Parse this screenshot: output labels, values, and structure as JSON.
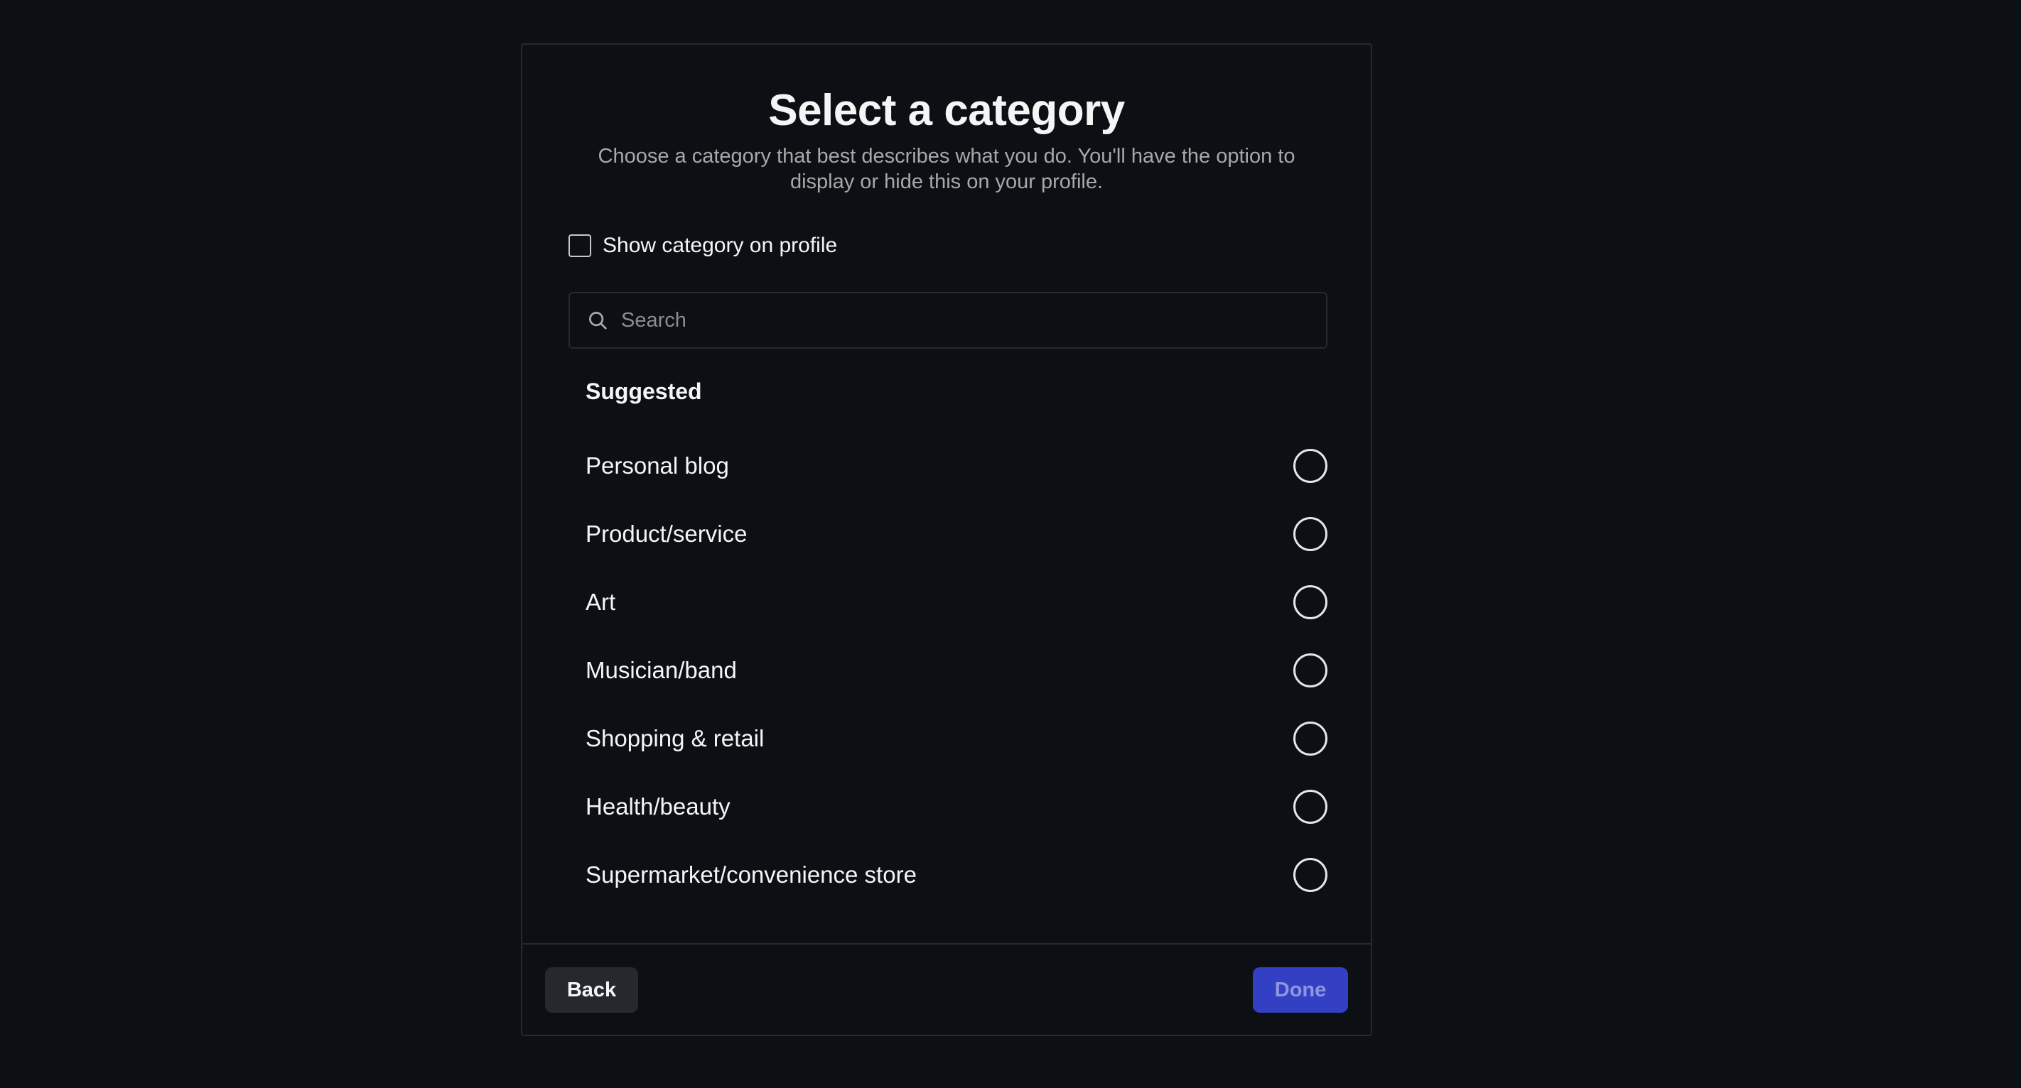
{
  "modal": {
    "title": "Select a category",
    "subtitle": "Choose a category that best describes what you do. You'll have the option to display or hide this on your profile.",
    "show_on_profile": {
      "label": "Show category on profile",
      "checked": false
    },
    "search": {
      "placeholder": "Search",
      "value": ""
    },
    "section_title": "Suggested",
    "categories": [
      {
        "label": "Personal blog",
        "selected": false
      },
      {
        "label": "Product/service",
        "selected": false
      },
      {
        "label": "Art",
        "selected": false
      },
      {
        "label": "Musician/band",
        "selected": false
      },
      {
        "label": "Shopping & retail",
        "selected": false
      },
      {
        "label": "Health/beauty",
        "selected": false
      },
      {
        "label": "Supermarket/convenience store",
        "selected": false
      }
    ]
  },
  "footer": {
    "back_label": "Back",
    "done_label": "Done"
  },
  "colors": {
    "background": "#0c1014",
    "border": "#262a2f",
    "text_primary": "#f5f5f5",
    "text_secondary": "#a8a8a8",
    "primary_button": "#3440c4",
    "primary_button_text": "#8f95e0",
    "secondary_button": "#25292e"
  },
  "icons": {
    "search": "search-icon"
  }
}
